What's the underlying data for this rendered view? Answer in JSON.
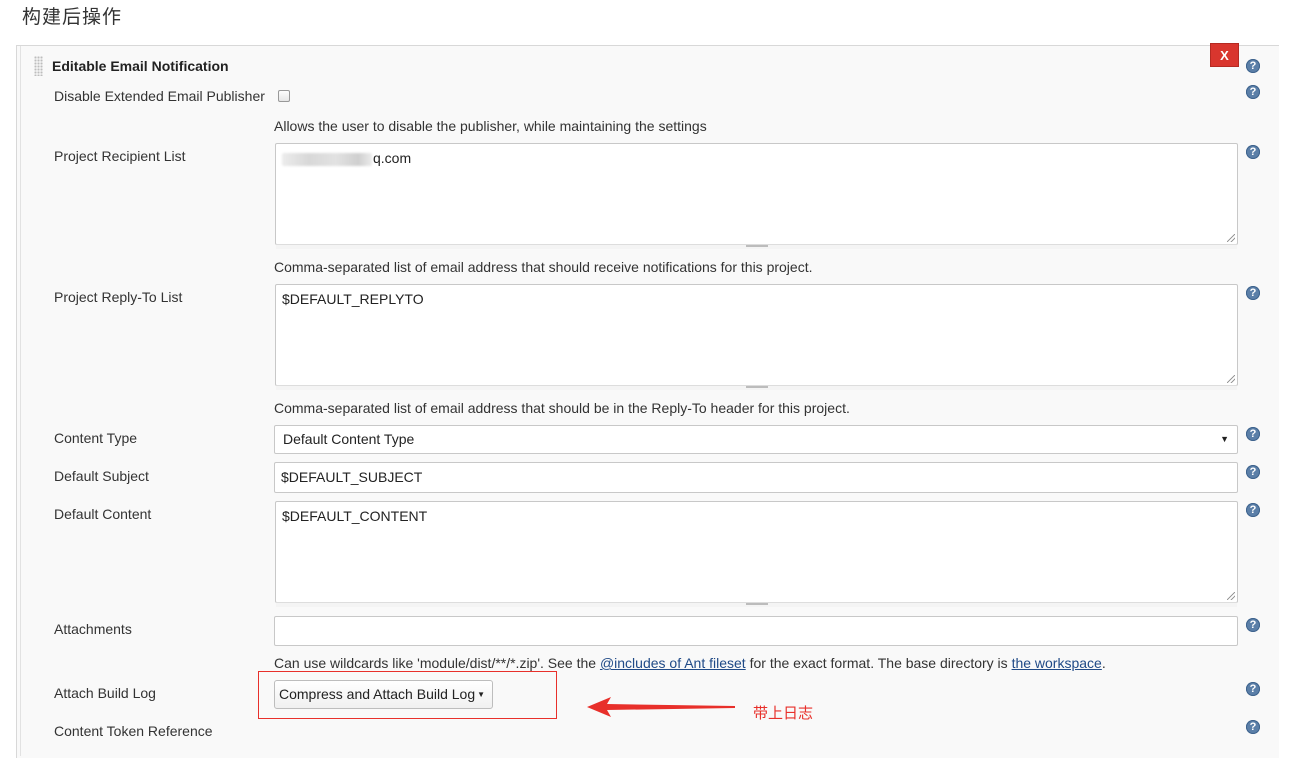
{
  "section": {
    "title": "构建后操作"
  },
  "publisher": {
    "title": "Editable Email Notification",
    "delete_label": "X"
  },
  "help_glyph": "?",
  "fields": {
    "disable_publisher": {
      "label": "Disable Extended Email Publisher",
      "checked": false,
      "description": "Allows the user to disable the publisher, while maintaining the settings"
    },
    "recipient_list": {
      "label": "Project Recipient List",
      "value_visible_suffix": "q.com",
      "description": "Comma-separated list of email address that should receive notifications for this project."
    },
    "reply_to_list": {
      "label": "Project Reply-To List",
      "value": "$DEFAULT_REPLYTO",
      "description": "Comma-separated list of email address that should be in the Reply-To header for this project."
    },
    "content_type": {
      "label": "Content Type",
      "selected": "Default Content Type"
    },
    "default_subject": {
      "label": "Default Subject",
      "value": "$DEFAULT_SUBJECT"
    },
    "default_content": {
      "label": "Default Content",
      "value": "$DEFAULT_CONTENT"
    },
    "attachments": {
      "label": "Attachments",
      "value": "",
      "description_prefix": "Can use wildcards like 'module/dist/**/*.zip'. See the ",
      "description_link1": "@includes of Ant fileset",
      "description_middle": " for the exact format. The base directory is ",
      "description_link2": "the workspace",
      "description_suffix": "."
    },
    "attach_build_log": {
      "label": "Attach Build Log",
      "selected": "Compress and Attach Build Log"
    },
    "content_token_reference": {
      "label": "Content Token Reference"
    }
  },
  "annotation": {
    "text": "带上日志",
    "color": "#e8302b"
  }
}
